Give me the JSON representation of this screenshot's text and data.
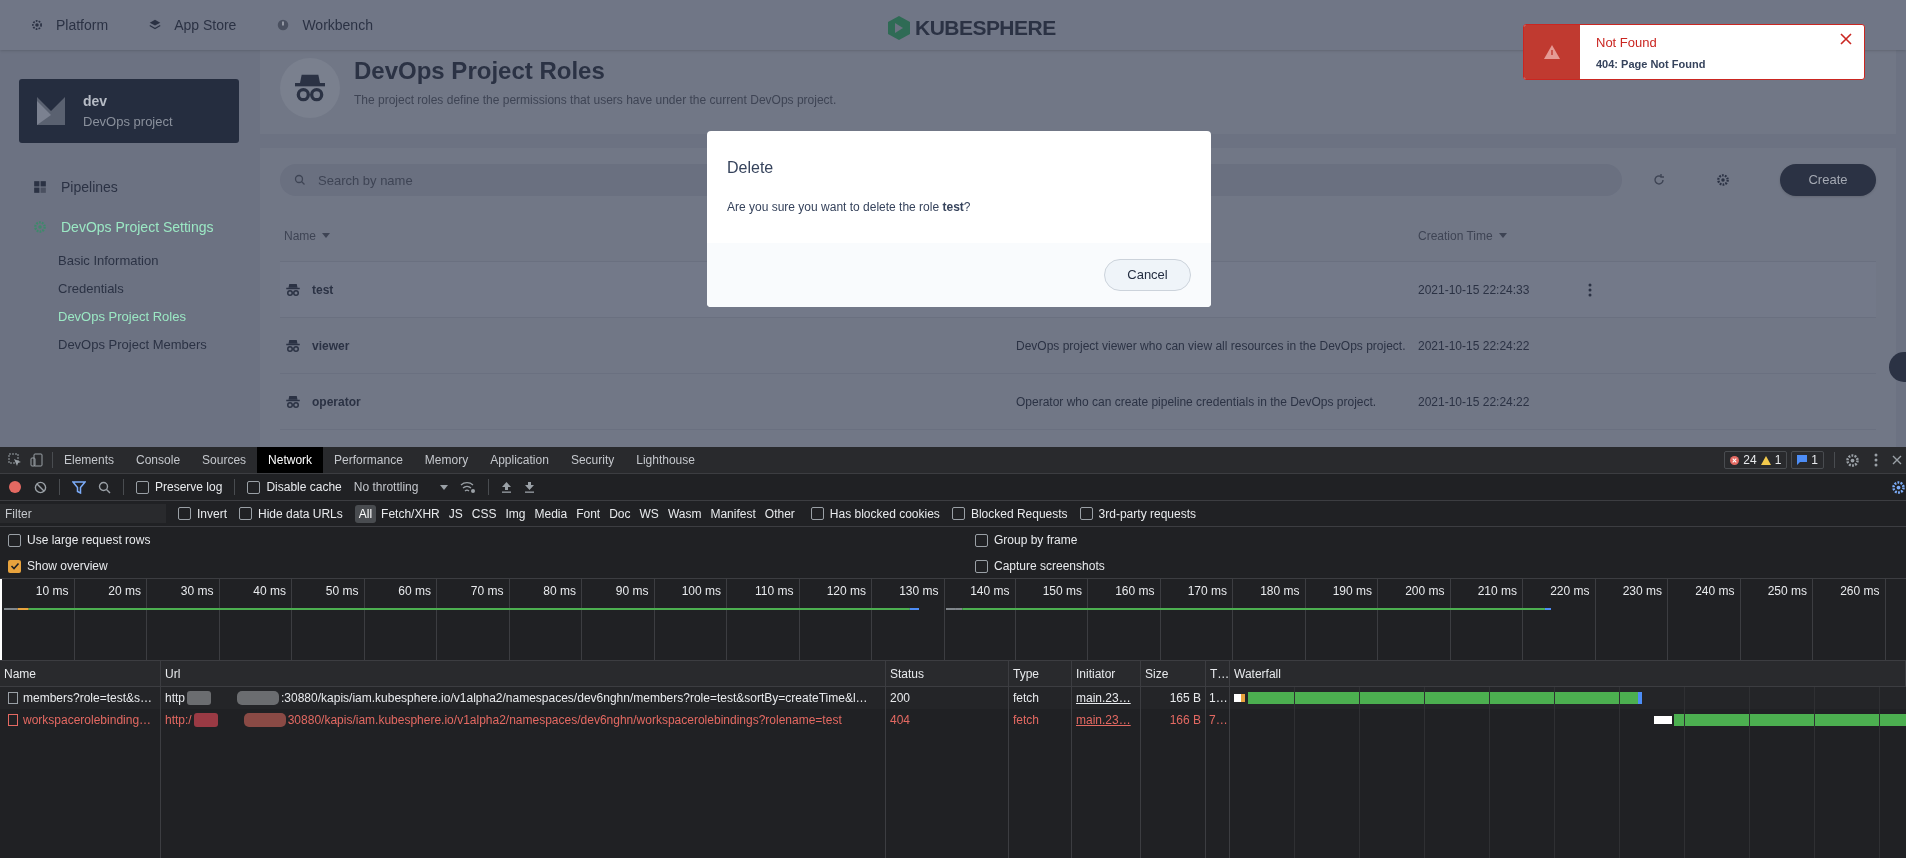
{
  "app": {
    "top_nav": [
      {
        "label": "Platform",
        "kind": "gear"
      },
      {
        "label": "App Store",
        "kind": "layers"
      },
      {
        "label": "Workbench",
        "kind": "gauge"
      }
    ],
    "logo": "KUBESPHERE",
    "project": {
      "name": "dev",
      "type": "DevOps project"
    },
    "sidebar": [
      {
        "label": "Pipelines",
        "kind": "pipelines",
        "selected": false
      },
      {
        "label": "DevOps Project Settings",
        "kind": "settings",
        "selected": true,
        "children": [
          {
            "label": "Basic Information",
            "selected": false
          },
          {
            "label": "Credentials",
            "selected": false
          },
          {
            "label": "DevOps Project Roles",
            "selected": true
          },
          {
            "label": "DevOps Project Members",
            "selected": false
          }
        ]
      }
    ],
    "header": {
      "title": "DevOps Project Roles",
      "description": "The project roles define the permissions that users have under the current DevOps project."
    },
    "search": {
      "placeholder": "Search by name"
    },
    "create_button": "Create",
    "columns": {
      "name": "Name",
      "creation_time": "Creation Time"
    },
    "rows": [
      {
        "name": "test",
        "description": "",
        "time": "2021-10-15 22:24:33",
        "hovered": true
      },
      {
        "name": "viewer",
        "description": "DevOps project viewer who can view all resources in the DevOps project.",
        "time": "2021-10-15 22:24:22",
        "hovered": false
      },
      {
        "name": "operator",
        "description": "Operator who can create pipeline credentials in the DevOps project.",
        "time": "2021-10-15 22:24:22",
        "hovered": false
      }
    ],
    "dialog": {
      "title": "Delete",
      "message": "Are you sure you want to delete the role **test**?",
      "cancel": "Cancel"
    },
    "toast": {
      "title": "Not Found",
      "message": "404: Page Not Found"
    }
  },
  "devtools": {
    "tabs": [
      {
        "label": "Elements",
        "selected": false
      },
      {
        "label": "Console",
        "selected": false
      },
      {
        "label": "Sources",
        "selected": false
      },
      {
        "label": "Network",
        "selected": true
      },
      {
        "label": "Performance",
        "selected": false
      },
      {
        "label": "Memory",
        "selected": false
      },
      {
        "label": "Application",
        "selected": false
      },
      {
        "label": "Security",
        "selected": false
      },
      {
        "label": "Lighthouse",
        "selected": false
      }
    ],
    "issues": {
      "errors": "24",
      "warnings": "1",
      "messages": "1"
    },
    "toolbar": {
      "recording": true,
      "preserve_log": {
        "label": "Preserve log",
        "checked": false
      },
      "disable_cache": {
        "label": "Disable cache",
        "checked": false
      },
      "throttling": "No throttling"
    },
    "filter": {
      "placeholder": "Filter",
      "invert": {
        "label": "Invert",
        "checked": false
      },
      "hide_data_urls": {
        "label": "Hide data URLs",
        "checked": false
      },
      "types": [
        {
          "label": "All",
          "selected": true
        },
        {
          "label": "Fetch/XHR",
          "selected": false
        },
        {
          "label": "JS",
          "selected": false
        },
        {
          "label": "CSS",
          "selected": false
        },
        {
          "label": "Img",
          "selected": false
        },
        {
          "label": "Media",
          "selected": false
        },
        {
          "label": "Font",
          "selected": false
        },
        {
          "label": "Doc",
          "selected": false
        },
        {
          "label": "WS",
          "selected": false
        },
        {
          "label": "Wasm",
          "selected": false
        },
        {
          "label": "Manifest",
          "selected": false
        },
        {
          "label": "Other",
          "selected": false
        }
      ],
      "extra": [
        {
          "label": "Has blocked cookies",
          "checked": false
        },
        {
          "label": "Blocked Requests",
          "checked": false
        },
        {
          "label": "3rd-party requests",
          "checked": false
        }
      ]
    },
    "options": [
      {
        "label": "Use large request rows",
        "checked": false
      },
      {
        "label": "Group by frame",
        "checked": false
      },
      {
        "label": "Show overview",
        "checked": true
      },
      {
        "label": "Capture screenshots",
        "checked": false
      }
    ],
    "timeline": {
      "ticks_left": [
        "10 ms",
        "20 ms",
        "30 ms",
        "40 ms",
        "50 ms",
        "60 ms",
        "70 ms",
        "80 ms",
        "90 ms",
        "100 ms",
        "110 ms",
        "120 ms",
        "130 ms"
      ],
      "ticks_right": [
        "140 ms",
        "150 ms",
        "160 ms",
        "170 ms",
        "180 ms",
        "190 ms",
        "200 ms",
        "210 ms",
        "220 ms",
        "230 ms",
        "240 ms",
        "250 ms",
        "260 ms"
      ]
    },
    "columns": [
      "Name",
      "Url",
      "Status",
      "Type",
      "Initiator",
      "Size",
      "T…",
      "Waterfall"
    ],
    "requests": [
      {
        "name": "members?role=test&s…",
        "url_prefix": "http",
        "url_rest": ":30880/kapis/iam.kubesphere.io/v1alpha2/namespaces/dev6nghn/members?role=test&sortBy=createTime&l…",
        "status": "200",
        "type": "fetch",
        "initiator": "main.23…",
        "size": "165 B",
        "time": "1…",
        "error": false
      },
      {
        "name": "workspacerolebinding…",
        "url_prefix": "http:/",
        "url_rest": "30880/kapis/iam.kubesphere.io/v1alpha2/namespaces/dev6nghn/workspacerolebindings?rolename=test",
        "status": "404",
        "type": "fetch",
        "initiator": "main.23…",
        "size": "166 B",
        "time": "7…",
        "error": true
      }
    ]
  }
}
